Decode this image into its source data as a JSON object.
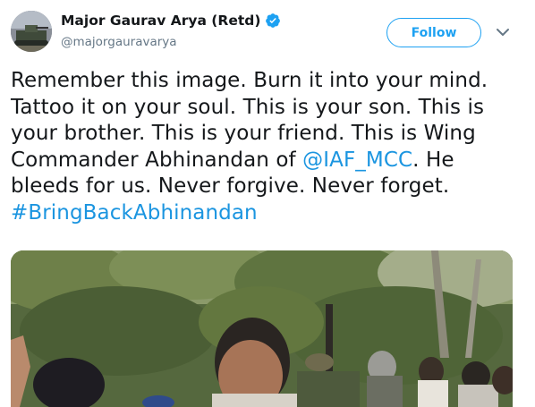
{
  "author": {
    "name": "Major Gaurav Arya (Retd)",
    "handle": "@majorgauravarya",
    "verified": true,
    "avatar_icon": "avatar-tank-photo"
  },
  "actions": {
    "follow_label": "Follow",
    "menu_icon": "chevron-down-icon"
  },
  "tweet": {
    "line1": "Remember this image. Burn it into your mind.",
    "line2": "Tattoo it on your soul. This is your son. This is",
    "line3": "your brother. This is your friend. This is Wing",
    "line4_pre": "Commander Abhinandan of ",
    "line4_mention": "@IAF_MCC",
    "line4_post": ". He",
    "line5": "bleeds for us. Never forgive. Never forget.",
    "hashtag": "#BringBackAbhinandan"
  },
  "colors": {
    "link": "#1b95e0",
    "follow": "#1da1f2",
    "text": "#14171a",
    "secondary": "#657786"
  }
}
